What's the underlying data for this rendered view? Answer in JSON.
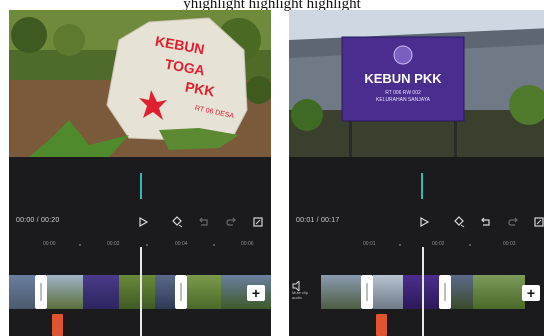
{
  "caption": "yhighlight highlight highlight",
  "left_screen": {
    "preview_sign": {
      "lines": [
        "KEBUN",
        "TOGA",
        "PKK",
        "RT 06 DESA"
      ]
    },
    "timecode": "00:00 / 00:20",
    "ruler_ticks": [
      "00:00",
      "00:02",
      "00:04",
      "00:06"
    ],
    "add_label": "+"
  },
  "right_screen": {
    "preview_sign": {
      "title": "KEBUN PKK",
      "subtitle": [
        "RT 006 RW 002",
        "KELURAHAN SANJAYA"
      ]
    },
    "timecode": "00:01 / 00:17",
    "ruler_ticks": [
      "00:01",
      "00:02",
      "00:03"
    ],
    "mute_label": "Mute clip audio",
    "add_label": "+"
  },
  "icons": {
    "play": "play-icon",
    "keyframe": "keyframe-icon",
    "undo": "undo-icon",
    "redo": "redo-icon",
    "fullscreen": "fullscreen-icon"
  },
  "colors": {
    "panel_bg": "#1c1c1e",
    "accent": "#2fb9b4",
    "marker": "#e0542f"
  }
}
